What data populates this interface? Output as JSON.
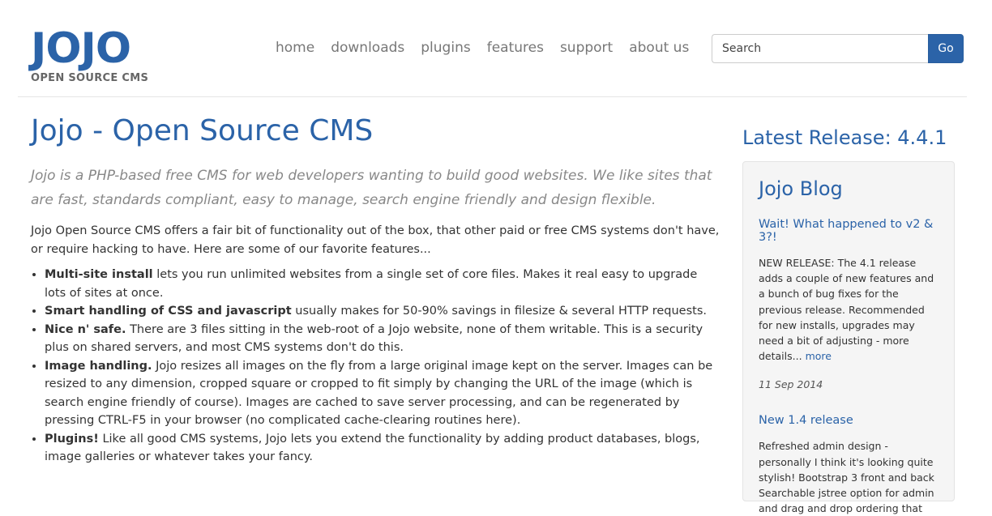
{
  "logo": {
    "word": "JOJO",
    "tagline": "OPEN SOURCE CMS"
  },
  "nav": [
    "home",
    "downloads",
    "plugins",
    "features",
    "support",
    "about us"
  ],
  "search": {
    "placeholder": "Search",
    "button_label": "Go"
  },
  "main": {
    "title": "Jojo - Open Source CMS",
    "lead": "Jojo is a PHP-based free CMS for web developers wanting to build good websites. We like sites that are fast, standards compliant, easy to manage, search engine friendly and design flexible.",
    "intro": "Jojo Open Source CMS offers a fair bit of functionality out of the box, that other paid or free CMS systems don't have, or require hacking to have. Here are some of our favorite features...",
    "features": [
      {
        "bold": "Multi-site install",
        "text": " lets you run unlimited websites from a single set of core files. Makes it real easy to upgrade lots of sites at once."
      },
      {
        "bold": "Smart handling of CSS and javascript",
        "text": " usually makes for 50-90% savings in filesize & several HTTP requests."
      },
      {
        "bold": "Nice n' safe.",
        "text": " There are 3 files sitting in the web-root of a Jojo website, none of them writable. This is a security plus on shared servers, and most CMS systems don't do this."
      },
      {
        "bold": "Image handling.",
        "text": " Jojo resizes all images on the fly from a large original image kept on the server. Images can be resized to any dimension, cropped square or cropped to fit simply by changing the URL of the image (which is search engine friendly of course). Images are cached to save server processing, and can be regenerated by pressing CTRL-F5 in your browser (no complicated cache-clearing routines here)."
      },
      {
        "bold": "Plugins!",
        "text": " Like all good CMS systems, Jojo lets you extend the functionality by adding product databases, blogs, image galleries or whatever takes your fancy."
      }
    ]
  },
  "sidebar": {
    "release": "Latest Release: 4.4.1",
    "blog_title": "Jojo Blog",
    "posts": [
      {
        "title": "Wait! What happened to v2 & 3?!",
        "body": "NEW RELEASE: The 4.1 release adds a couple of new features and a bunch of bug fixes for the previous release. Recommended for new installs, upgrades may need a bit of adjusting - more details...",
        "more": "more",
        "date": "11 Sep 2014"
      },
      {
        "title": "New 1.4 release",
        "body": "Refreshed admin design - personally I think it's looking quite stylish! Bootstrap 3 front and back Searchable jstree option for admin and drag and drop ordering that"
      }
    ]
  }
}
